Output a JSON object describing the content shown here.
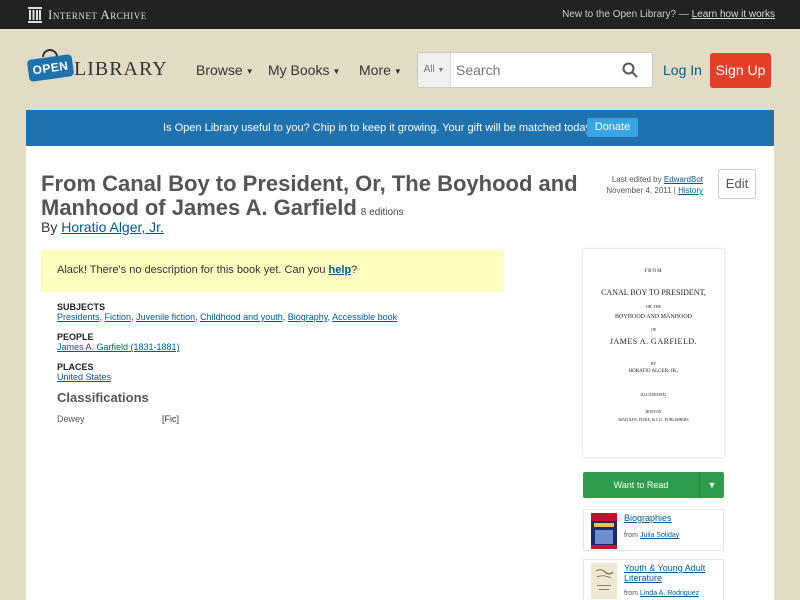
{
  "ia_bar": {
    "logo_text": "Internet Archive",
    "new_text": "New to the Open Library? —",
    "learn_link": "Learn how it works"
  },
  "header": {
    "logo_badge": "OPEN",
    "logo_text": "LIBRARY",
    "nav": [
      "Browse",
      "My Books",
      "More"
    ],
    "search_scope": "All",
    "search_placeholder": "Search",
    "login": "Log In",
    "signup": "Sign Up"
  },
  "banner": {
    "text": "Is Open Library useful to you? Chip in to keep it growing. Your gift will be matched today!",
    "button": "Donate"
  },
  "book": {
    "title": "From Canal Boy to President, Or, The Boyhood and Manhood of James A. Garfield",
    "editions": "8 editions",
    "by": "By",
    "author": "Horatio Alger, Jr.",
    "last_edited_prefix": "Last edited by",
    "last_edited_user": "EdwardBot",
    "last_edited_date": "November 4, 2011 |",
    "history": "History",
    "edit_button": "Edit"
  },
  "description": {
    "text_before": "Alack! There's no description for this book yet. Can you",
    "help_link": "help",
    "text_after": "?"
  },
  "subjects": {
    "label": "Subjects",
    "items": [
      "Presidents",
      "Fiction",
      "Juvenile fiction",
      "Childhood and youth",
      "Biography",
      "Accessible book"
    ]
  },
  "people": {
    "label": "People",
    "items": [
      "James A. Garfield (1831-1881)"
    ]
  },
  "places": {
    "label": "Places",
    "items": [
      "United States"
    ]
  },
  "classifications": {
    "title": "Classifications",
    "dewey_label": "Dewey",
    "dewey_value": "[Fic]"
  },
  "cover": {
    "line1": "FROM",
    "line2": "CANAL BOY TO PRESIDENT,",
    "line3": "OR, THE",
    "line4": "BOYHOOD AND MANHOOD",
    "line5": "OF",
    "line6": "JAMES A. GARFIELD.",
    "line7": "BY",
    "line8": "HORATIO ALGER, JR.,",
    "line9": "ILLUSTRATED.",
    "line10": "BOSTON",
    "line11": "DeWOLFE, FISKE, & CO., PUBLISHERS"
  },
  "want_to_read": {
    "label": "Want to Read"
  },
  "lists": [
    {
      "name": "Biographies",
      "from": "from",
      "user": "Julia Soliday"
    },
    {
      "name": "Youth & Young Adult Literature",
      "from": "from",
      "user": "Linda A. Rodriguez"
    }
  ],
  "colors": {
    "banner": "#1f72ae",
    "signup": "#e44028",
    "want_to_read": "#2e9c4c",
    "link": "#02598b"
  }
}
